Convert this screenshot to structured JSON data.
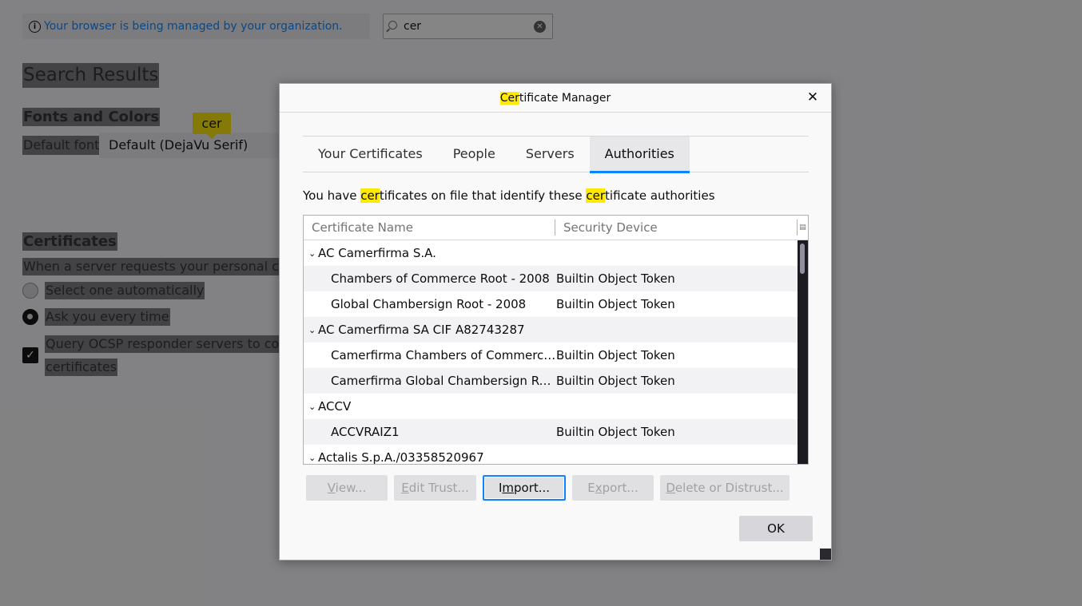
{
  "background": {
    "managed_notice": "Your browser is being managed by your organization.",
    "search_value": "cer",
    "search_results_title": "Search Results",
    "fonts_colors_title": "Fonts and Colors",
    "default_font_label": "Default font",
    "default_font_value": "Default (DejaVu Serif)",
    "search_tooltip": "cer",
    "certificates_title": "Certificates",
    "certificates_desc": "When a server requests your personal certificate",
    "option_auto": "Select one automatically",
    "option_ask": "Ask you every time",
    "ocsp_line1": "Query OCSP responder servers to confirm",
    "ocsp_line2": "certificates"
  },
  "dialog": {
    "title_hl": "Cer",
    "title_rest": "tificate Manager",
    "tabs": [
      {
        "label": "Your Certificates",
        "active": false
      },
      {
        "label": "People",
        "active": false
      },
      {
        "label": "Servers",
        "active": false
      },
      {
        "label": "Authorities",
        "active": true
      }
    ],
    "intro": {
      "p1": "You have ",
      "h1": "cer",
      "p2": "tificates on file that identify these ",
      "h2": "cer",
      "p3": "tificate authorities"
    },
    "columns": {
      "name": "Certificate Name",
      "device": "Security Device"
    },
    "rows": [
      {
        "group": "AC Camerfirma S.A."
      },
      {
        "name": "Chambers of Commerce Root - 2008",
        "device": "Builtin Object Token"
      },
      {
        "name": "Global Chambersign Root - 2008",
        "device": "Builtin Object Token"
      },
      {
        "group": "AC Camerfirma SA CIF A82743287"
      },
      {
        "name": "Camerfirma Chambers of Commerce…",
        "device": "Builtin Object Token"
      },
      {
        "name": "Camerfirma Global Chambersign Root",
        "device": "Builtin Object Token"
      },
      {
        "group": "ACCV"
      },
      {
        "name": "ACCVRAIZ1",
        "device": "Builtin Object Token"
      },
      {
        "group": "Actalis S.p.A./03358520967"
      }
    ],
    "buttons": {
      "view": {
        "pre": "",
        "u": "V",
        "post": "iew..."
      },
      "edit": {
        "pre": "",
        "u": "E",
        "post": "dit Trust..."
      },
      "import": {
        "pre": "I",
        "u": "m",
        "post": "port..."
      },
      "export": {
        "pre": "E",
        "u": "x",
        "post": "port..."
      },
      "delete": {
        "pre": "",
        "u": "D",
        "post": "elete or Distrust..."
      },
      "ok": "OK"
    }
  }
}
